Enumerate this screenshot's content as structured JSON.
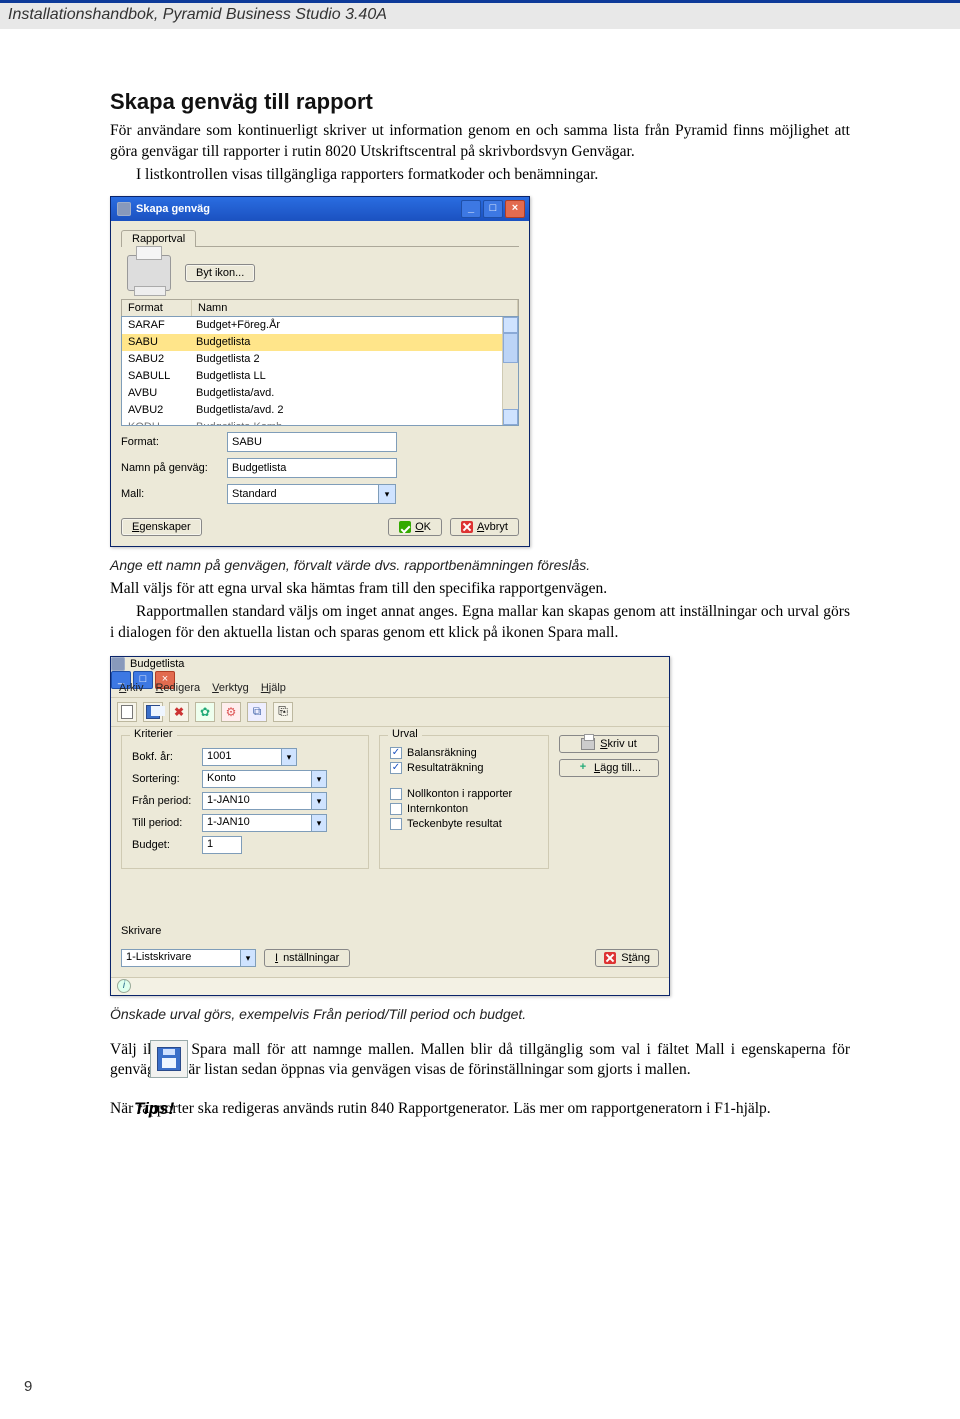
{
  "header": {
    "title": "Installationshandbok, Pyramid Business Studio 3.40A"
  },
  "section": {
    "title": "Skapa genväg till rapport",
    "p1": "För användare som kontinuerligt skriver ut information genom en och samma lista från Pyramid finns möjlighet att göra genvägar till rapporter i rutin 8020 Utskriftscentral på skrivbordsvyn Genvägar.",
    "p2": "I listkontrollen visas tillgängliga rapporters formatkoder och benämningar.",
    "caption1": "Ange ett namn på genvägen, förvalt värde dvs. rapportbenämningen föreslås.",
    "p3": "Mall väljs för att egna urval ska hämtas fram till den specifika rapportgenvägen.",
    "p4": "Rapportmallen standard väljs om inget annat anges. Egna mallar kan skapas genom att inställningar och urval görs i dialogen för den aktuella listan och sparas genom ett klick på ikonen Spara mall.",
    "caption2": "Önskade urval görs, exempelvis Från period/Till period och budget.",
    "p5": "Välj ikonen Spara mall för att namnge mallen. Mallen blir då tillgänglig som val i fältet Mall i egenskaperna för genvägen. När listan sedan öppnas via genvägen visas de förinställningar som gjorts i mallen.",
    "tips_label": "Tips!",
    "tips_text": "När rapporter ska redigeras används rutin 840 Rapportgenerator. Läs mer om rapportgeneratorn i F1-hjälp."
  },
  "dlg1": {
    "title": "Skapa genväg",
    "tab": "Rapportval",
    "change_icon": "Byt ikon...",
    "col_format": "Format",
    "col_name": "Namn",
    "rows": [
      {
        "fmt": "SARAF",
        "name": "Budget+Föreg.År"
      },
      {
        "fmt": "SABU",
        "name": "Budgetlista"
      },
      {
        "fmt": "SABU2",
        "name": "Budgetlista 2"
      },
      {
        "fmt": "SABULL",
        "name": "Budgetlista LL"
      },
      {
        "fmt": "AVBU",
        "name": "Budgetlista/avd."
      },
      {
        "fmt": "AVBU2",
        "name": "Budgetlista/avd. 2"
      },
      {
        "fmt": "KODU",
        "name": "Budgetlista Komb"
      }
    ],
    "selected_index": 1,
    "lbl_format": "Format:",
    "val_format": "SABU",
    "lbl_shortcut": "Namn på genväg:",
    "val_shortcut": "Budgetlista",
    "lbl_mall": "Mall:",
    "val_mall": "Standard",
    "btn_props": "Egenskaper",
    "btn_ok": "OK",
    "btn_cancel": "Avbryt"
  },
  "dlg2": {
    "title": "Budgetlista",
    "menu": {
      "arkiv": "Arkiv",
      "redigera": "Redigera",
      "verktyg": "Verktyg",
      "hjalp": "Hjälp"
    },
    "group_kriterier": "Kriterier",
    "group_urval": "Urval",
    "lbl_bokfar": "Bokf. år:",
    "val_bokfar": "1001",
    "lbl_sort": "Sortering:",
    "val_sort": "Konto",
    "lbl_fran": "Från period:",
    "val_fran": "1-JAN10",
    "lbl_till": "Till period:",
    "val_till": "1-JAN10",
    "lbl_budget": "Budget:",
    "val_budget": "1",
    "chk_balans": "Balansräkning",
    "chk_resultat": "Resultaträkning",
    "chk_noll": "Nollkonton i rapporter",
    "chk_intern": "Internkonton",
    "chk_tecken": "Teckenbyte resultat",
    "btn_skrivut": "Skriv ut",
    "btn_lagg": "Lägg till...",
    "lbl_skrivare": "Skrivare",
    "val_skrivare": "1-Listskrivare",
    "btn_install": "Inställningar",
    "btn_stang": "Stäng"
  },
  "page_number": "9"
}
